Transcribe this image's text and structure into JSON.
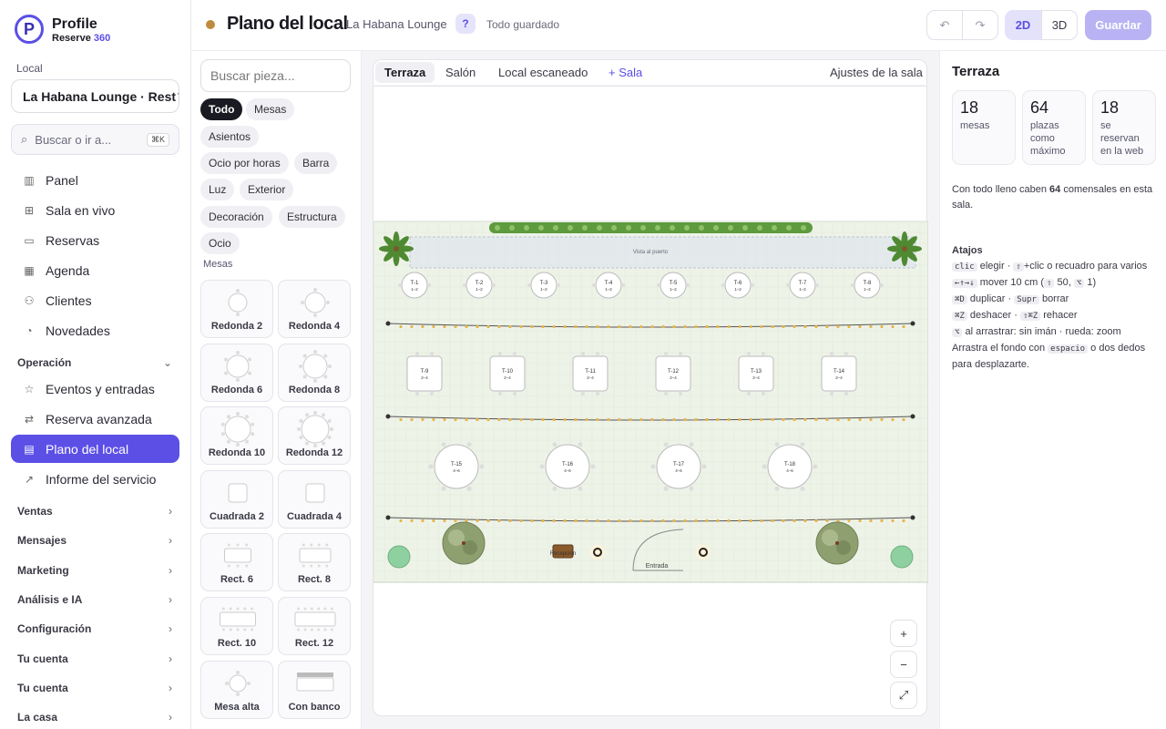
{
  "brand": {
    "name": "Profile",
    "sub": "Reserve",
    "sub_accent": "360"
  },
  "sidebar": {
    "local_label": "Local",
    "local_value": "La Habana Lounge · Rest",
    "search_placeholder": "Buscar o ir a...",
    "search_kbd": "⌘K",
    "nav": [
      {
        "label": "Panel",
        "icon": "chart-icon"
      },
      {
        "label": "Sala en vivo",
        "icon": "grid-icon"
      },
      {
        "label": "Reservas",
        "icon": "calendar-icon"
      },
      {
        "label": "Agenda",
        "icon": "table-icon"
      },
      {
        "label": "Clientes",
        "icon": "users-icon"
      },
      {
        "label": "Novedades",
        "icon": "bell-icon"
      }
    ],
    "operacion_label": "Operación",
    "operacion_items": [
      {
        "label": "Eventos y entradas",
        "icon": "star-icon"
      },
      {
        "label": "Reserva avanzada",
        "icon": "swap-icon"
      },
      {
        "label": "Plano del local",
        "icon": "map-icon",
        "active": true
      },
      {
        "label": "Informe del servicio",
        "icon": "trend-icon"
      }
    ],
    "groups": [
      "Ventas",
      "Mensajes",
      "Marketing",
      "Análisis e IA",
      "Configuración",
      "Tu cuenta",
      "Tu cuenta",
      "La casa"
    ]
  },
  "header": {
    "title": "Plano del local",
    "subtitle": "La Habana Lounge",
    "help": "?",
    "status": "Todo guardado",
    "undo": "↶",
    "redo": "↷",
    "view_2d": "2D",
    "view_3d": "3D",
    "save": "Guardar"
  },
  "pieces": {
    "search_placeholder": "Buscar pieza...",
    "filters": [
      "Todo",
      "Mesas",
      "Asientos",
      "Ocio por horas",
      "Barra",
      "Luz",
      "Exterior",
      "Decoración",
      "Estructura",
      "Ocio"
    ],
    "section": "Mesas",
    "items": [
      "Redonda 2",
      "Redonda 4",
      "Redonda 6",
      "Redonda 8",
      "Redonda 10",
      "Redonda 12",
      "Cuadrada 2",
      "Cuadrada 4",
      "Rect. 6",
      "Rect. 8",
      "Rect. 10",
      "Rect. 12",
      "Mesa alta",
      "Con banco"
    ]
  },
  "canvas": {
    "tabs": [
      "Terraza",
      "Salón",
      "Local escaneado"
    ],
    "add_room": "+ Sala",
    "room_settings": "Ajustes de la sala",
    "view_label": "Vista al puerto",
    "reception": "Recepción",
    "entrance": "Entrada",
    "row1": [
      {
        "id": "T-1",
        "cap": "1–2"
      },
      {
        "id": "T-2",
        "cap": "1–2"
      },
      {
        "id": "T-3",
        "cap": "1–2"
      },
      {
        "id": "T-4",
        "cap": "1–2"
      },
      {
        "id": "T-5",
        "cap": "1–2"
      },
      {
        "id": "T-6",
        "cap": "1–2"
      },
      {
        "id": "T-7",
        "cap": "1–2"
      },
      {
        "id": "T-8",
        "cap": "1–2"
      }
    ],
    "row2": [
      {
        "id": "T-9",
        "cap": "2–4"
      },
      {
        "id": "T-10",
        "cap": "2–4"
      },
      {
        "id": "T-11",
        "cap": "2–4"
      },
      {
        "id": "T-12",
        "cap": "2–4"
      },
      {
        "id": "T-13",
        "cap": "2–4"
      },
      {
        "id": "T-14",
        "cap": "2–4"
      }
    ],
    "row3": [
      {
        "id": "T-15",
        "cap": "4–6"
      },
      {
        "id": "T-16",
        "cap": "4–6"
      },
      {
        "id": "T-17",
        "cap": "4–6"
      },
      {
        "id": "T-18",
        "cap": "4–6"
      }
    ],
    "zoom_in": "+",
    "zoom_out": "−",
    "fit": "⤢"
  },
  "right": {
    "title": "Terraza",
    "stats": [
      {
        "n": "18",
        "t": "mesas"
      },
      {
        "n": "64",
        "t": "plazas como máximo"
      },
      {
        "n": "18",
        "t": "se reservan en la web"
      }
    ],
    "capacity_pre": "Con todo lleno caben ",
    "capacity_num": "64",
    "capacity_post": " comensales en esta sala.",
    "shortcuts_title": "Atajos",
    "s1": {
      "k1": "clic",
      "t1": " elegir · ",
      "k2": "⇧",
      "t2": "+clic o recuadro para varios"
    },
    "s2": {
      "k1": "←↑→↓",
      "t1": " mover 10 cm (",
      "k2": "⇧",
      "t2": " 50, ",
      "k3": "⌥",
      "t3": " 1)"
    },
    "s3": {
      "k1": "⌘D",
      "t1": " duplicar · ",
      "k2": "Supr",
      "t2": " borrar"
    },
    "s4": {
      "k1": "⌘Z",
      "t1": " deshacer · ",
      "k2": "⇧⌘Z",
      "t2": " rehacer"
    },
    "s5": {
      "k1": "⌥",
      "t1": " al arrastrar: sin imán · rueda: zoom"
    },
    "s6": {
      "t1": "Arrastra el fondo con ",
      "k1": "espacio",
      "t2": " o dos dedos para desplazarte."
    }
  },
  "colors": {
    "accent": "#5b4fe6",
    "accent_soft": "#b9b3f4",
    "floor": "#eef3e8",
    "hedge": "#5e9a3e",
    "light": "#e8b44a"
  }
}
